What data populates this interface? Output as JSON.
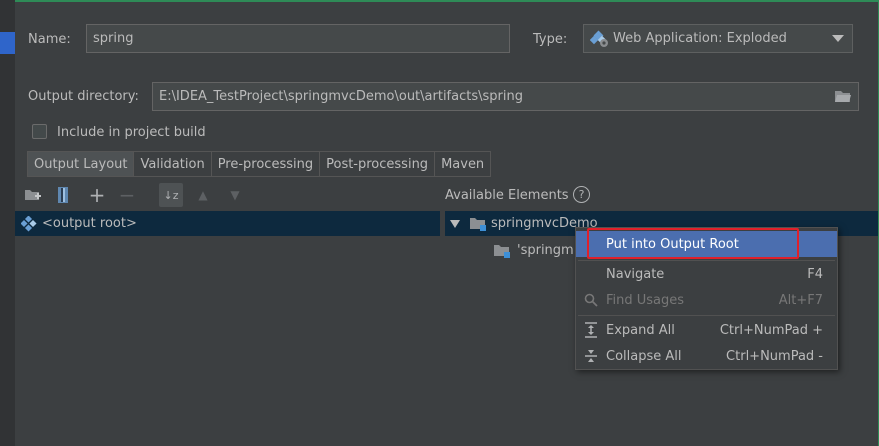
{
  "form": {
    "name_label": "Name:",
    "name_value": "spring",
    "type_label": "Type:",
    "type_value": "Web Application: Exploded",
    "output_dir_label": "Output directory:",
    "output_dir_value": "E:\\IDEA_TestProject\\springmvcDemo\\out\\artifacts\\spring",
    "include_build_label": "Include in project build",
    "include_build_checked": false
  },
  "tabs": [
    {
      "label": "Output Layout",
      "active": true
    },
    {
      "label": "Validation",
      "active": false
    },
    {
      "label": "Pre-processing",
      "active": false
    },
    {
      "label": "Post-processing",
      "active": false
    },
    {
      "label": "Maven",
      "active": false
    }
  ],
  "layout_tree": {
    "root_label": "<output root>"
  },
  "available_elements": {
    "title": "Available Elements",
    "help_glyph": "?",
    "module_label": "springmvcDemo",
    "child_label": "'springm"
  },
  "context_menu": {
    "items": [
      {
        "label": "Put into Output Root",
        "shortcut": "",
        "icon": "",
        "highlighted": true,
        "enabled": true
      },
      {
        "label": "Navigate",
        "shortcut": "F4",
        "icon": "",
        "highlighted": false,
        "enabled": true
      },
      {
        "label": "Find Usages",
        "shortcut": "Alt+F7",
        "icon": "search-icon",
        "highlighted": false,
        "enabled": false
      },
      {
        "label": "Expand All",
        "shortcut": "Ctrl+NumPad +",
        "icon": "expand-all-icon",
        "highlighted": false,
        "enabled": true
      },
      {
        "label": "Collapse All",
        "shortcut": "Ctrl+NumPad -",
        "icon": "collapse-all-icon",
        "highlighted": false,
        "enabled": true
      }
    ]
  },
  "colors": {
    "background": "#3c3f41",
    "selection": "#0d293e",
    "menu_highlight": "#4b6eaf",
    "annotation_red": "#e0202a"
  }
}
